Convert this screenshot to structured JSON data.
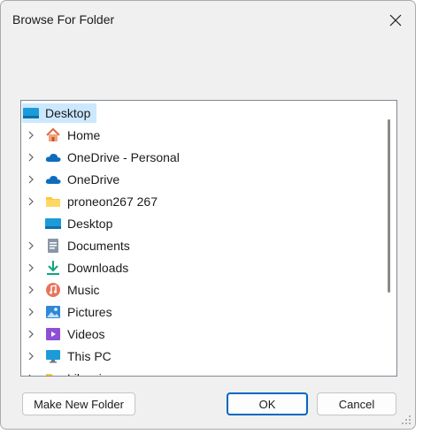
{
  "window": {
    "title": "Browse For Folder"
  },
  "tree": {
    "root": {
      "label": "Desktop",
      "icon": "desktop-icon",
      "selected": true
    },
    "items": [
      {
        "label": "Home",
        "icon": "home-icon",
        "expandable": true
      },
      {
        "label": "OneDrive - Personal",
        "icon": "cloud-icon",
        "expandable": true
      },
      {
        "label": "OneDrive",
        "icon": "cloud-icon",
        "expandable": true
      },
      {
        "label": "proneon267 267",
        "icon": "folder-icon",
        "expandable": true
      },
      {
        "label": "Desktop",
        "icon": "desktop-icon",
        "expandable": false
      },
      {
        "label": "Documents",
        "icon": "documents-icon",
        "expandable": true
      },
      {
        "label": "Downloads",
        "icon": "download-icon",
        "expandable": true
      },
      {
        "label": "Music",
        "icon": "music-icon",
        "expandable": true
      },
      {
        "label": "Pictures",
        "icon": "pictures-icon",
        "expandable": true
      },
      {
        "label": "Videos",
        "icon": "videos-icon",
        "expandable": true
      },
      {
        "label": "This PC",
        "icon": "monitor-icon",
        "expandable": true
      },
      {
        "label": "Libraries",
        "icon": "folder-icon",
        "expandable": true
      }
    ]
  },
  "buttons": {
    "make_new_folder": "Make New Folder",
    "ok": "OK",
    "cancel": "Cancel"
  },
  "colors": {
    "selection": "#cce8ff",
    "accent": "#0067c0",
    "dialog_bg": "#f0f0f0"
  }
}
